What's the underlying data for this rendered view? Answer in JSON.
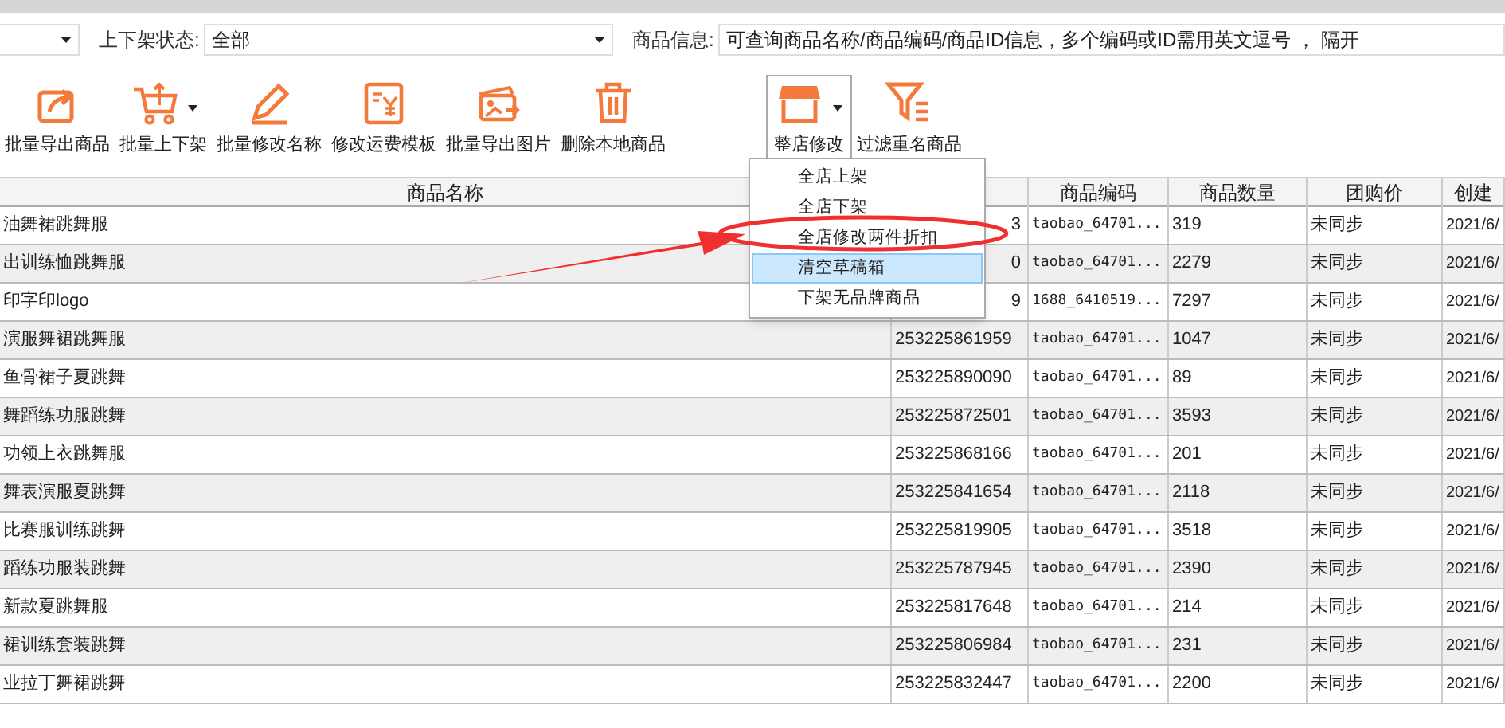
{
  "filters": {
    "status_label": "上下架状态:",
    "status_value": "全部",
    "info_label": "商品信息:",
    "info_placeholder": "可查询商品名称/商品编码/商品ID信息，多个编码或ID需用英文逗号 ， 隔开"
  },
  "toolbar": [
    {
      "kind": "export",
      "label": "批量导出商品",
      "dropdown": false,
      "pressed": false
    },
    {
      "kind": "cart",
      "label": "批量上下架",
      "dropdown": true,
      "pressed": false
    },
    {
      "kind": "pencil",
      "label": "批量修改名称",
      "dropdown": false,
      "pressed": false
    },
    {
      "kind": "yen",
      "label": "修改运费模板",
      "dropdown": false,
      "pressed": false
    },
    {
      "kind": "images",
      "label": "批量导出图片",
      "dropdown": false,
      "pressed": false
    },
    {
      "kind": "trash",
      "label": "删除本地商品",
      "dropdown": false,
      "pressed": false
    },
    {
      "kind": "shop",
      "label": "整店修改",
      "dropdown": true,
      "pressed": true
    },
    {
      "kind": "filter",
      "label": "过滤重名商品",
      "dropdown": false,
      "pressed": false
    }
  ],
  "menu": {
    "items": [
      {
        "label": "全店上架",
        "selected": false
      },
      {
        "label": "全店下架",
        "selected": false
      },
      {
        "label": "全店修改两件折扣",
        "selected": false
      },
      {
        "label": "清空草稿箱",
        "selected": true
      },
      {
        "label": "下架无品牌商品",
        "selected": false
      }
    ]
  },
  "table": {
    "columns": [
      "商品名称",
      "",
      "商品编码",
      "商品数量",
      "团购价",
      "创建"
    ],
    "rows": [
      {
        "cells": [
          "油舞裙跳舞服",
          "3",
          "taobao_64701...",
          "319",
          "未同步",
          "2021/6/"
        ]
      },
      {
        "cells": [
          "出训练恤跳舞服",
          "0",
          "taobao_64701...",
          "2279",
          "未同步",
          "2021/6/"
        ]
      },
      {
        "cells": [
          "印字印logo",
          "9",
          "1688_6410519...",
          "7297",
          "未同步",
          "2021/6/"
        ]
      },
      {
        "cells": [
          "演服舞裙跳舞服",
          "253225861959",
          "taobao_64701...",
          "1047",
          "未同步",
          "2021/6/"
        ]
      },
      {
        "cells": [
          "鱼骨裙子夏跳舞",
          "253225890090",
          "taobao_64701...",
          "89",
          "未同步",
          "2021/6/"
        ]
      },
      {
        "cells": [
          "舞蹈练功服跳舞",
          "253225872501",
          "taobao_64701...",
          "3593",
          "未同步",
          "2021/6/"
        ]
      },
      {
        "cells": [
          "功领上衣跳舞服",
          "253225868166",
          "taobao_64701...",
          "201",
          "未同步",
          "2021/6/"
        ]
      },
      {
        "cells": [
          "舞表演服夏跳舞",
          "253225841654",
          "taobao_64701...",
          "2118",
          "未同步",
          "2021/6/"
        ]
      },
      {
        "cells": [
          "比赛服训练跳舞",
          "253225819905",
          "taobao_64701...",
          "3518",
          "未同步",
          "2021/6/"
        ]
      },
      {
        "cells": [
          "蹈练功服装跳舞",
          "253225787945",
          "taobao_64701...",
          "2390",
          "未同步",
          "2021/6/"
        ]
      },
      {
        "cells": [
          "新款夏跳舞服",
          "253225817648",
          "taobao_64701...",
          "214",
          "未同步",
          "2021/6/"
        ]
      },
      {
        "cells": [
          "裙训练套装跳舞",
          "253225806984",
          "taobao_64701...",
          "231",
          "未同步",
          "2021/6/"
        ]
      },
      {
        "cells": [
          "业拉丁舞裙跳舞",
          "253225832447",
          "taobao_64701...",
          "2200",
          "未同步",
          "2021/6/"
        ]
      }
    ]
  }
}
